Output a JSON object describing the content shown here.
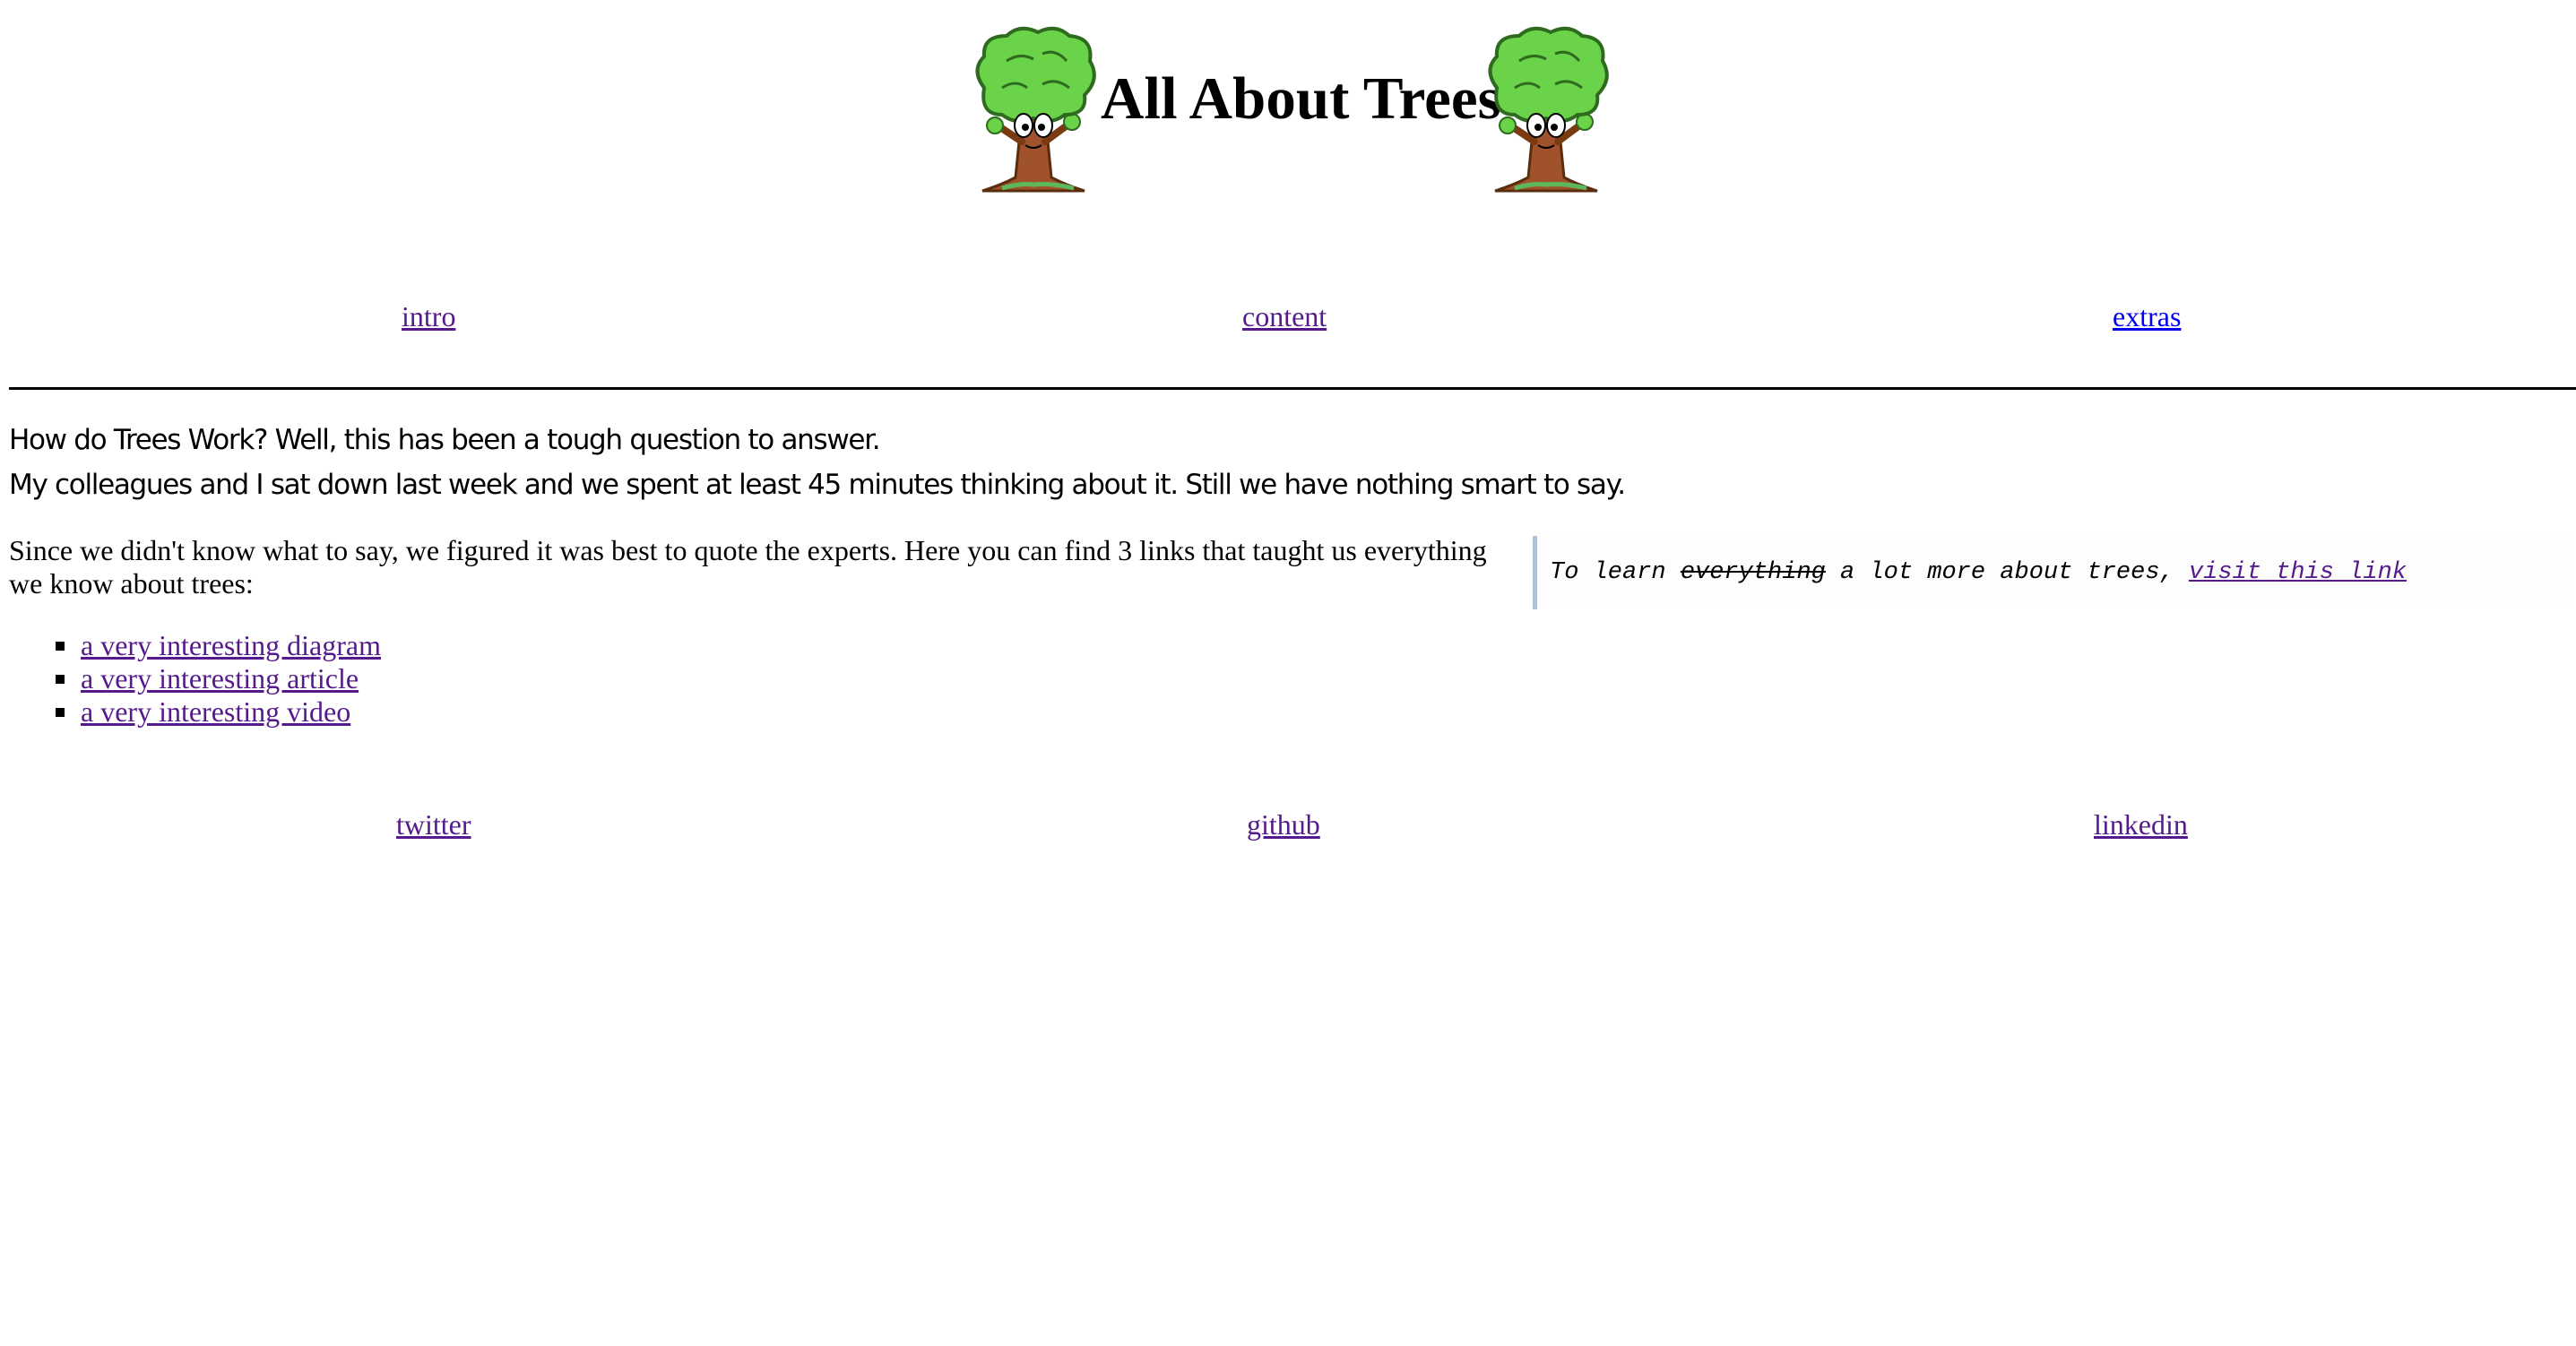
{
  "header": {
    "title": "All About Trees",
    "tree_icon": "cartoon-tree-icon"
  },
  "nav": {
    "items": [
      {
        "label": "intro"
      },
      {
        "label": "content"
      },
      {
        "label": "extras"
      }
    ]
  },
  "intro": {
    "line1": "How do Trees Work? Well, this has been a tough question to answer.",
    "line2": "My colleagues and I sat down last week and we spent at least 45 minutes thinking about it. Still we have nothing smart to say."
  },
  "content": {
    "paragraph": "Since we didn't know what to say, we figured it was best to quote the experts. Here you can find 3 links that taught us everything we know about trees:",
    "links": [
      {
        "label": "a very interesting diagram"
      },
      {
        "label": "a very interesting article"
      },
      {
        "label": "a very interesting video"
      }
    ]
  },
  "aside": {
    "prefix": "To learn ",
    "struck": "everything",
    "middle": " a lot more about trees, ",
    "link_label": "visit this link"
  },
  "footer": {
    "items": [
      {
        "label": "twitter"
      },
      {
        "label": "github"
      },
      {
        "label": "linkedin"
      }
    ]
  },
  "colors": {
    "link_visited": "#551a8b",
    "link_unvisited": "#0000ee",
    "aside_border": "#b0c4d8"
  }
}
